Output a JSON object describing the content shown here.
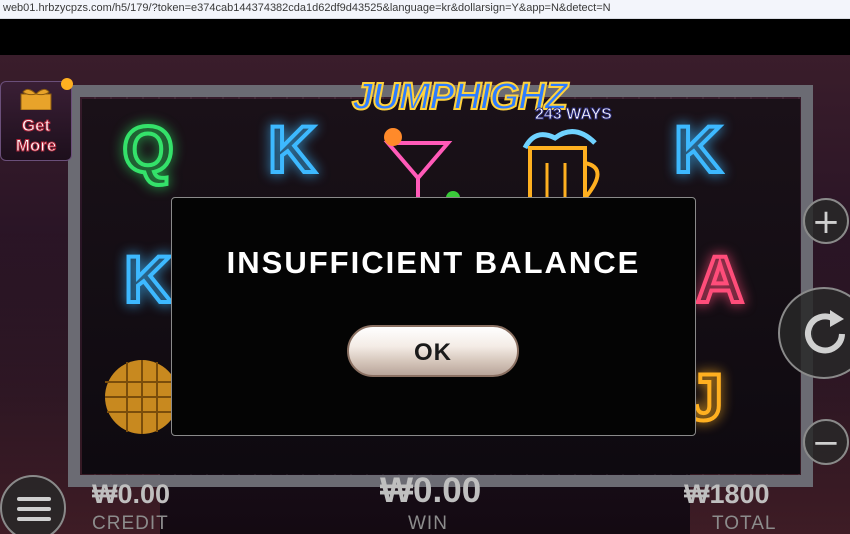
{
  "browser": {
    "url": "web01.hrbzycpzs.com/h5/179/?token=e374cab144374382cda1d62df9d43525&language=kr&dollarsign=Y&app=N&detect=N"
  },
  "game": {
    "logo_title": "JUMPHIGHZ",
    "logo_ways": "243 WAYS",
    "get_more": {
      "line1": "Get",
      "line2": "More"
    },
    "reel_symbols": [
      "Q",
      "K",
      "K",
      "K",
      "A",
      "J"
    ]
  },
  "modal": {
    "title": "INSUFFICIENT BALANCE",
    "ok_label": "OK"
  },
  "controls": {
    "plus": "+",
    "minus": "−"
  },
  "footer": {
    "credit_value": "₩0.00",
    "credit_label": "CREDIT",
    "win_value": "₩0.00",
    "win_label": "WIN",
    "total_value": "₩1800",
    "total_label": "TOTAL"
  },
  "colors": {
    "modal_bg": "#040404",
    "neon_green": "#34e26a",
    "neon_blue": "#3db9ff",
    "neon_red": "#ff4d7a",
    "neon_yellow": "#ffb020"
  },
  "icons": [
    "gift-icon",
    "plus-icon",
    "refresh-icon",
    "minus-icon",
    "menu-icon",
    "cocktail-icon",
    "beer-mug-icon",
    "disco-ball-icon"
  ]
}
